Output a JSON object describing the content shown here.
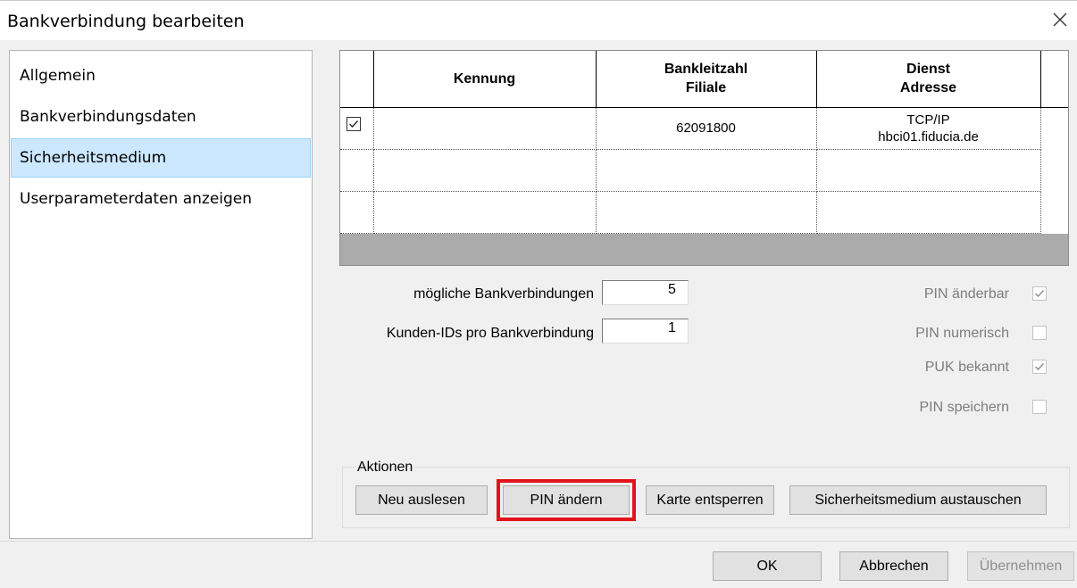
{
  "window": {
    "title": "Bankverbindung bearbeiten"
  },
  "sidebar": {
    "items": [
      {
        "label": "Allgemein"
      },
      {
        "label": "Bankverbindungsdaten"
      },
      {
        "label": "Sicherheitsmedium",
        "selected": true
      },
      {
        "label": "Userparameterdaten anzeigen"
      }
    ]
  },
  "grid": {
    "headers": [
      "Kennung",
      "Bankleitzahl\nFiliale",
      "Dienst\nAdresse"
    ],
    "rows": [
      {
        "checked": true,
        "kennung": "",
        "blz": "62091800",
        "dienst": "TCP/IP\nhbci01.fiducia.de"
      },
      {
        "checked": false,
        "kennung": "",
        "blz": "",
        "dienst": ""
      },
      {
        "checked": false,
        "kennung": "",
        "blz": "",
        "dienst": ""
      }
    ]
  },
  "fields": {
    "moegliche_label": "mögliche Bankverbindungen",
    "moegliche_value": "5",
    "kunden_label": "Kunden-IDs pro Bankverbindung",
    "kunden_value": "1"
  },
  "options": [
    {
      "label": "PIN änderbar",
      "checked": true
    },
    {
      "label": "PIN numerisch",
      "checked": false
    },
    {
      "label": "PUK bekannt",
      "checked": true
    },
    {
      "label": "PIN speichern",
      "checked": false
    }
  ],
  "actions": {
    "group_label": "Aktionen",
    "neu_auslesen": "Neu auslesen",
    "pin_aendern": "PIN ändern",
    "karte_entsperren": "Karte entsperren",
    "sicherheitsmedium_austauschen": "Sicherheitsmedium austauschen"
  },
  "footer": {
    "ok": "OK",
    "abbrechen": "Abbrechen",
    "uebernehmen": "Übernehmen"
  },
  "colors": {
    "selection": "#cce8ff",
    "highlight": "#e3121b"
  }
}
